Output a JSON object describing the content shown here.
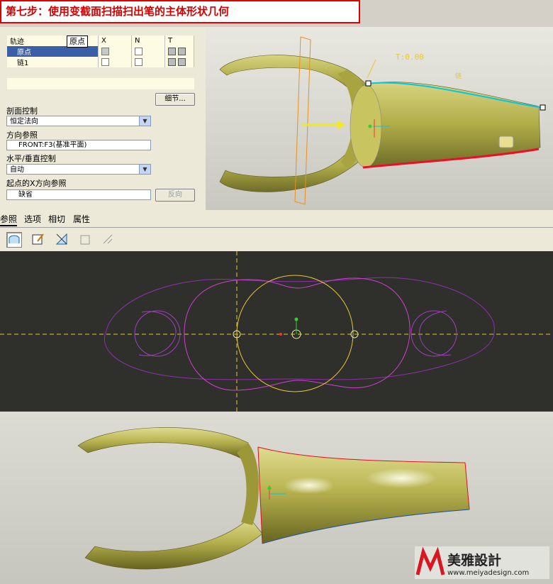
{
  "title": "第七步：使用变截面扫描扫出笔的主体形状几何",
  "trajectory_table": {
    "headers": [
      "轨迹",
      "X",
      "N",
      "T"
    ],
    "rows": [
      {
        "name": "原点",
        "selected": true
      },
      {
        "name": "链1",
        "selected": false
      }
    ]
  },
  "tooltip": "原点",
  "details_button": "细节...",
  "section_control": {
    "label": "剖面控制",
    "value": "恒定法向"
  },
  "direction_ref": {
    "label": "方向参照",
    "value": "FRONT:F3(基准平面)"
  },
  "hv_control": {
    "label": "水平/垂直控制",
    "value": "自动"
  },
  "start_x_ref": {
    "label": "起点的X方向参照",
    "value": "缺省",
    "button": "反向"
  },
  "tabs": [
    "参照",
    "选项",
    "相切",
    "属性"
  ],
  "toolbar": {
    "icons": [
      "surface-sweep-icon",
      "sketch-edit-icon",
      "cut-material-icon",
      "thicken-icon",
      "remove-icon"
    ]
  },
  "viewport_top": {
    "t_label": "T:0.00",
    "chain_label": "链"
  },
  "watermark": {
    "brand": "美雅設計",
    "url": "www.meiyadesign.com"
  },
  "colors": {
    "title_red": "#d40000",
    "model_olive": "#b8b350",
    "sketch_bg": "#2f2f2b",
    "trajectory_cyan": "#00c8e8",
    "trajectory_red": "#e8102a",
    "axis_yellow": "#e8c830"
  }
}
